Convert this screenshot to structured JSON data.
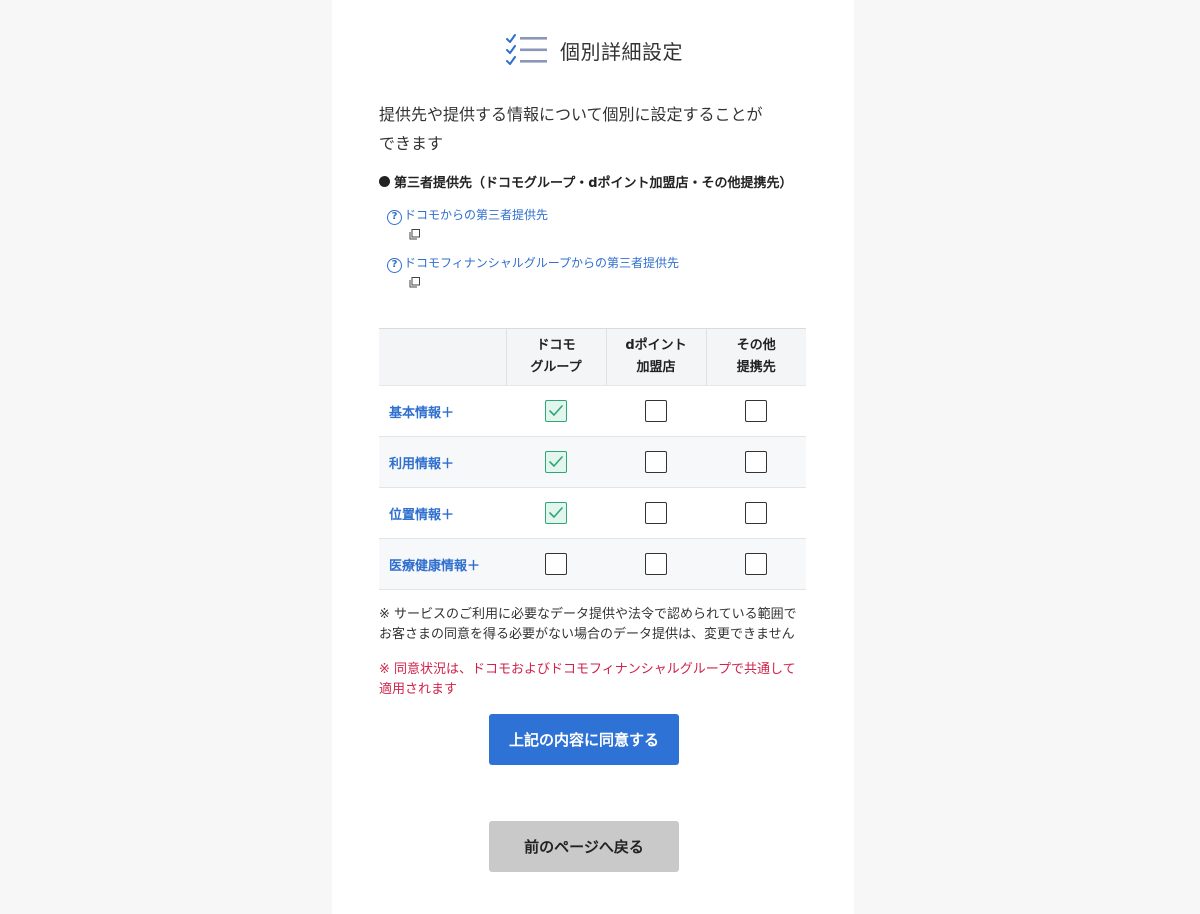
{
  "header": {
    "title": "個別詳細設定",
    "icon": "checklist-icon"
  },
  "intro": {
    "line1": "提供先や提供する情報について個別に設定することが",
    "line2": "できます"
  },
  "section": {
    "title": "第三者提供先（ドコモグループ・dポイント加盟店・その他提携先）"
  },
  "links": [
    {
      "label": "ドコモからの第三者提供先",
      "icon": "help-circle-icon",
      "ext_icon": "external-window-icon"
    },
    {
      "label": "ドコモフィナンシャルグループからの第三者提供先",
      "icon": "help-circle-icon",
      "ext_icon": "external-window-icon"
    }
  ],
  "table": {
    "columns": [
      {
        "line1": "ドコモ",
        "line2": "グループ"
      },
      {
        "line1": "dポイント",
        "line2": "加盟店"
      },
      {
        "line1": "その他",
        "line2": "提携先"
      }
    ],
    "rows": [
      {
        "label": "基本情報＋",
        "values": [
          true,
          false,
          false
        ]
      },
      {
        "label": "利用情報＋",
        "values": [
          true,
          false,
          false
        ]
      },
      {
        "label": "位置情報＋",
        "values": [
          true,
          false,
          false
        ]
      },
      {
        "label": "医療健康情報＋",
        "values": [
          false,
          false,
          false
        ]
      }
    ]
  },
  "notes": {
    "note_line1": "※ サービスのご利用に必要なデータ提供や法令で認められている範囲で",
    "note_line2": "お客さまの同意を得る必要がない場合のデータ提供は、変更できません",
    "red_line1": "※ 同意状況は、ドコモおよびドコモフィナンシャルグループで共通して",
    "red_line2": "適用されます"
  },
  "buttons": {
    "agree": "上記の内容に同意する",
    "back": "前のページへ戻る"
  },
  "colors": {
    "accent": "#2f72d6",
    "link": "#2f6fce",
    "checked_bg": "#e2f6ee",
    "checked_border": "#2fa67a",
    "warning": "#d0224a"
  }
}
